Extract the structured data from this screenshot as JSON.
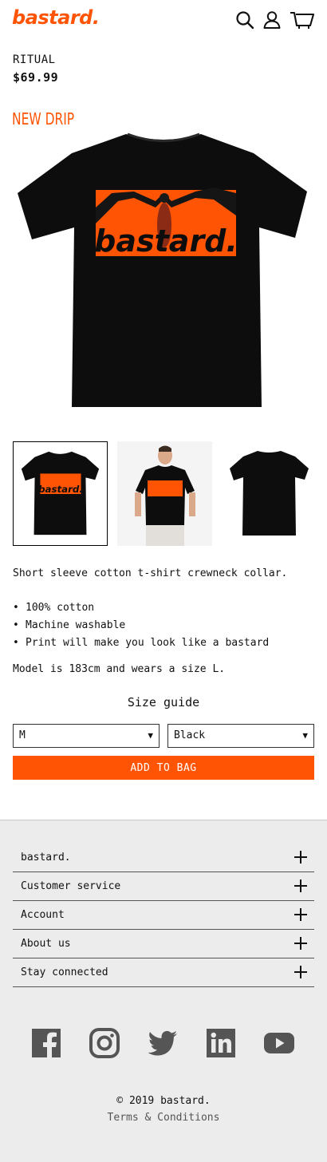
{
  "colors": {
    "accent": "#ff5404",
    "footer_bg": "#ececec",
    "text": "#111111",
    "social_grey": "#555555"
  },
  "header": {
    "logo": "bastard.",
    "icons": [
      "search-icon",
      "user-icon",
      "cart-icon"
    ]
  },
  "product": {
    "name": "RITUAL",
    "price": "$69.99",
    "badge": "NEW DRIP",
    "print_text": "bastard.",
    "description": "Short sleeve cotton t-shirt crewneck collar.",
    "features": [
      "100% cotton",
      "Machine washable",
      "Print will make you look like a bastard"
    ],
    "model_note": "Model is 183cm and wears a size L.",
    "size_guide": "Size guide",
    "size_selected": "M",
    "color_selected": "Black",
    "add_to_bag": "ADD TO BAG",
    "select_arrow": "▼",
    "thumbnails": [
      "front",
      "model",
      "back"
    ]
  },
  "footer": {
    "sections": [
      "bastard.",
      "Customer service",
      "Account",
      "About us",
      "Stay connected"
    ],
    "social": [
      "facebook-icon",
      "instagram-icon",
      "twitter-icon",
      "linkedin-icon",
      "youtube-icon"
    ],
    "copyright": "© 2019 bastard.",
    "terms": "Terms & Conditions"
  }
}
